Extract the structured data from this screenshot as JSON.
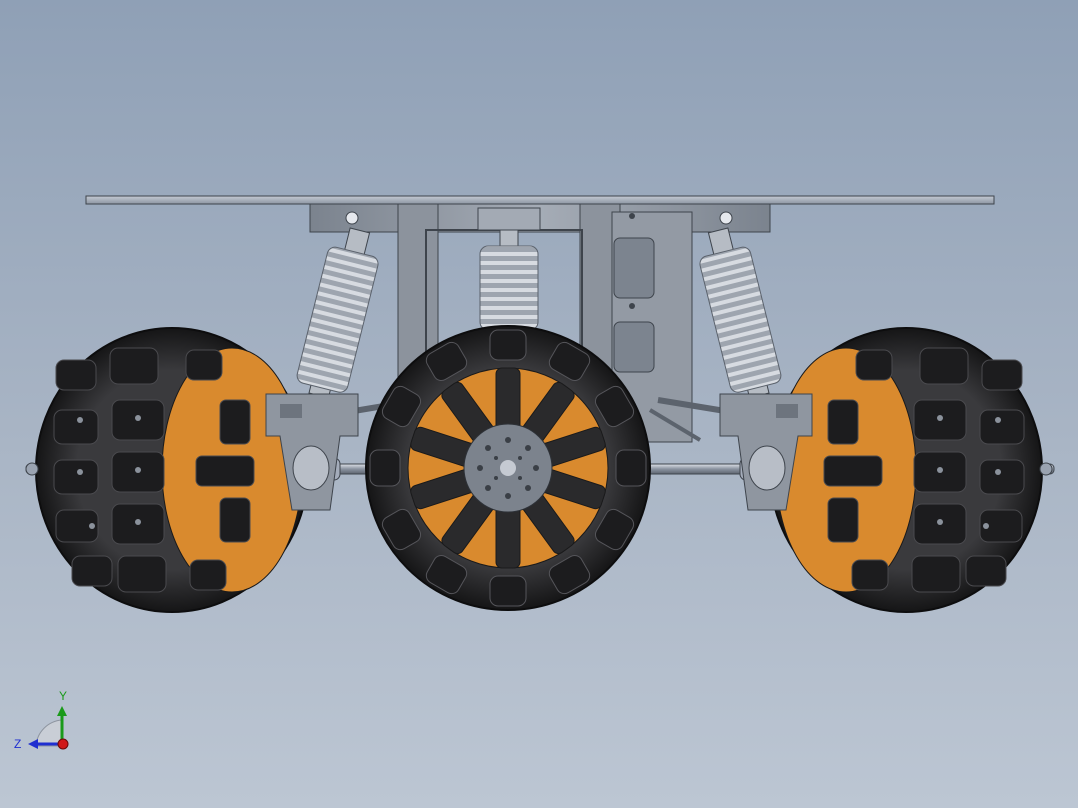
{
  "triad": {
    "y_label": "Y",
    "z_label": "Z",
    "y_color": "#1a9a1a",
    "z_color": "#1f2fd0",
    "x_color": "#d01818"
  },
  "palette": {
    "background_top": "#8fa0b6",
    "background_bottom": "#bcc6d3",
    "plate": "#9ea6b2",
    "frame": "#8e959f",
    "tire": "#2a2a2c",
    "roller": "#1c1c1e",
    "hub_orange": "#d98a2e",
    "hub_grey": "#7c838d",
    "spring": "#b7bdc6",
    "axle": "#9aa3b1"
  },
  "model_icons": [
    "chassis-model",
    "omni-wheel",
    "spring-shock",
    "axle",
    "top-plate"
  ]
}
